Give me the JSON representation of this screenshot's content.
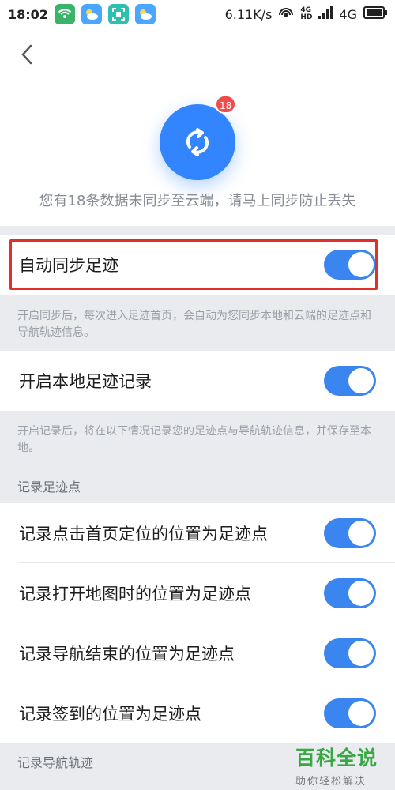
{
  "status_bar": {
    "time": "18:02",
    "speed": "6.11K/s",
    "network_small_top": "4G",
    "network_small_bottom": "HD",
    "network_type": "4G"
  },
  "header": {
    "badge_count": "18",
    "message": "您有18条数据未同步至云端，请马上同步防止丢失"
  },
  "settings": {
    "auto_sync": {
      "label": "自动同步足迹",
      "enabled": true
    },
    "auto_sync_desc": "开启同步后，每次进入足迹首页，会自动为您同步本地和云端的足迹点和导航轨迹信息。",
    "local_record": {
      "label": "开启本地足迹记录",
      "enabled": true
    },
    "local_record_desc": "开启记录后，将在以下情况记录您的足迹点与导航轨迹信息，并保存至本地。",
    "section_points": "记录足迹点",
    "points": [
      {
        "label": "记录点击首页定位的位置为足迹点",
        "enabled": true
      },
      {
        "label": "记录打开地图时的位置为足迹点",
        "enabled": true
      },
      {
        "label": "记录导航结束的位置为足迹点",
        "enabled": true
      },
      {
        "label": "记录签到的位置为足迹点",
        "enabled": true
      }
    ],
    "section_nav": "记录导航轨迹"
  },
  "watermark": {
    "title": "百科全说",
    "subtitle": "助你轻松解决"
  },
  "colors": {
    "accent": "#3a85f0",
    "badge": "#f24b4b",
    "highlight": "#e0302b",
    "watermark": "#39a844"
  }
}
